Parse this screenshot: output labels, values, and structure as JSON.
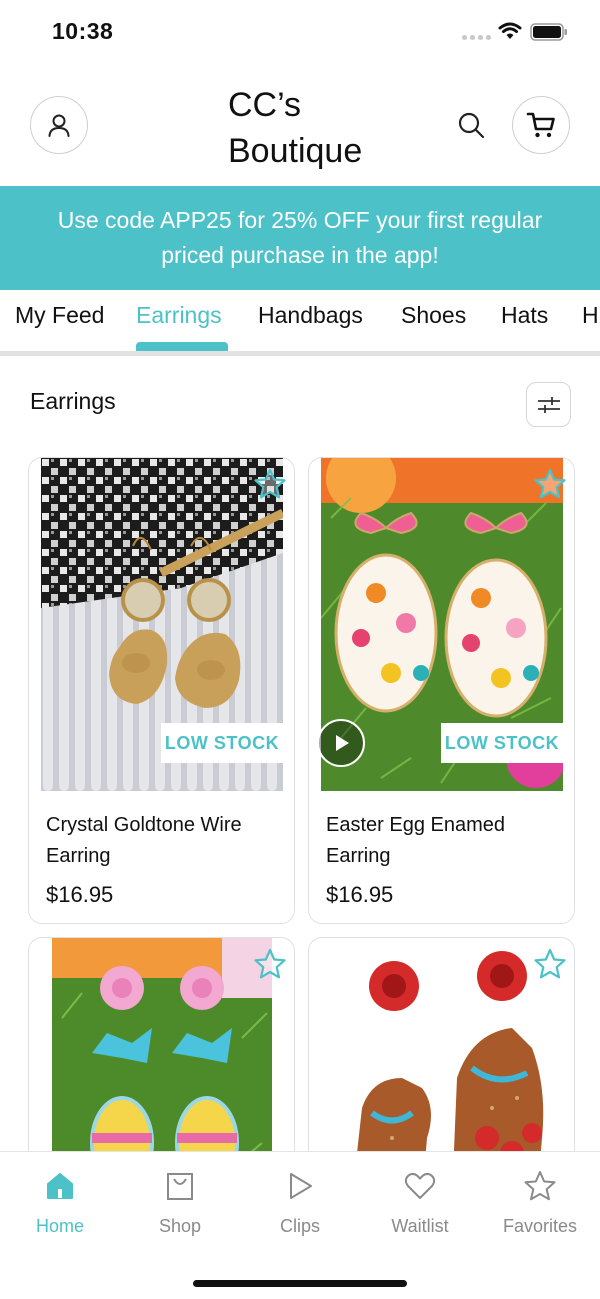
{
  "status_bar": {
    "time": "10:38"
  },
  "header": {
    "title": "CC’s Boutique",
    "profile_icon": "person-icon",
    "search_icon": "search-icon",
    "cart_icon": "cart-icon"
  },
  "promo": {
    "text": "Use code APP25 for 25% OFF your first regular priced purchase in the app!"
  },
  "tabs": [
    {
      "label": "My Feed"
    },
    {
      "label": "Earrings",
      "active": true
    },
    {
      "label": "Handbags"
    },
    {
      "label": "Shoes"
    },
    {
      "label": "Hats"
    },
    {
      "label": "H"
    }
  ],
  "section": {
    "title": "Earrings",
    "filter_icon": "sliders-icon"
  },
  "products": [
    {
      "name": "Crystal Goldtone Wire Earring",
      "price": "$16.95",
      "badge": "LOW STOCK",
      "has_video": false
    },
    {
      "name": "Easter Egg Enamed Earring",
      "price": "$16.95",
      "badge": "LOW STOCK",
      "has_video": true
    },
    {
      "name": "",
      "price": "",
      "badge": "",
      "has_video": false
    },
    {
      "name": "",
      "price": "",
      "badge": "",
      "has_video": false
    }
  ],
  "bottom_nav": [
    {
      "label": "Home",
      "icon": "home-icon",
      "active": true
    },
    {
      "label": "Shop",
      "icon": "shopping-bag-icon"
    },
    {
      "label": "Clips",
      "icon": "play-icon"
    },
    {
      "label": "Waitlist",
      "icon": "heart-icon"
    },
    {
      "label": "Favorites",
      "icon": "star-icon"
    }
  ],
  "colors": {
    "accent": "#4cc1c7",
    "text": "#111111",
    "muted": "#8a8a8a"
  }
}
